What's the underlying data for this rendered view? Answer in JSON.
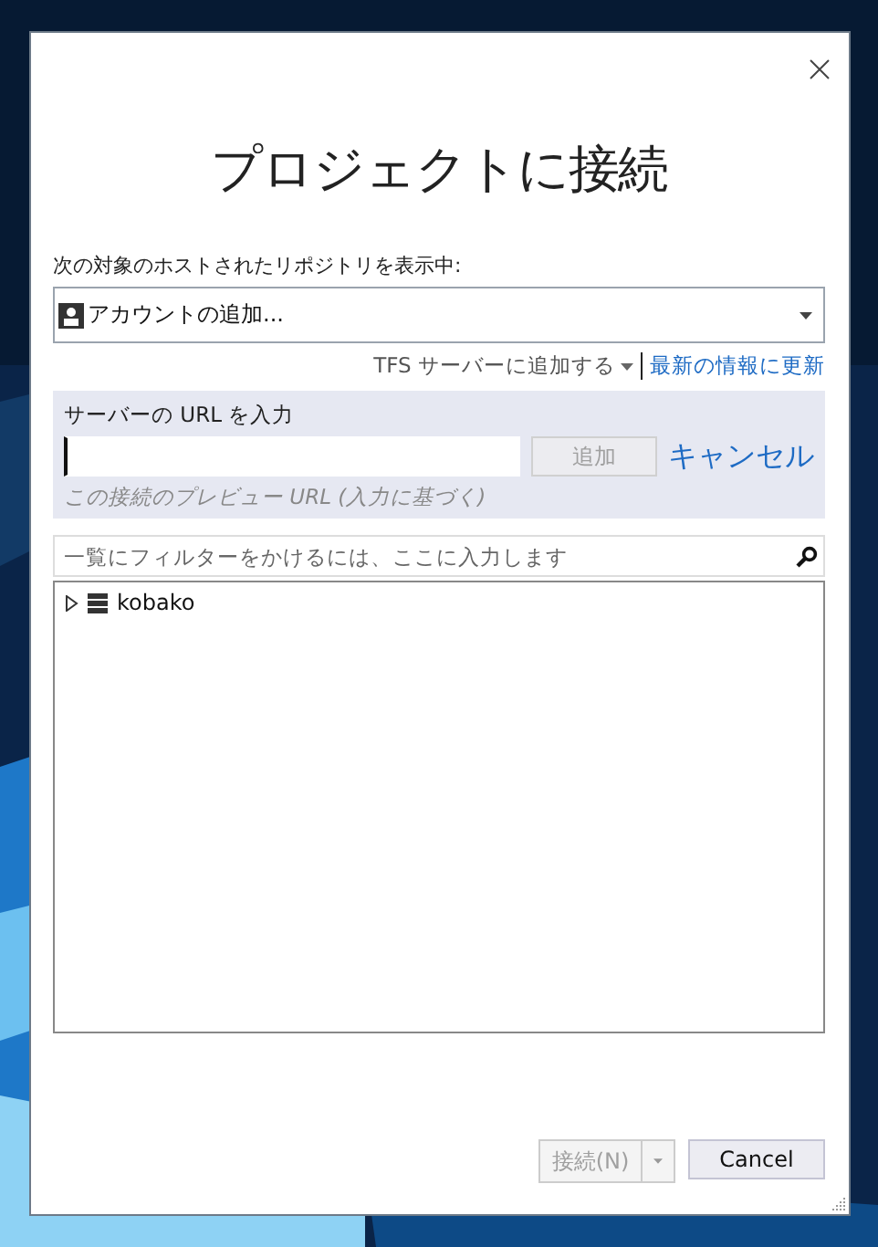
{
  "dialog": {
    "title": "プロジェクトに接続"
  },
  "repository": {
    "label": "次の対象のホストされたリポジトリを表示中:",
    "value": "アカウントの追加..."
  },
  "links": [
    {
      "kind": "menu",
      "label": "TFS サーバーに追加する"
    },
    {
      "kind": "link",
      "label": "最新の情報に更新"
    }
  ],
  "server_panel": {
    "label": "サーバーの URL を入力",
    "add_button": {
      "label": "追加",
      "disabled": true
    },
    "cancel_link": "キャンセル",
    "hint": "この接続のプレビュー URL (入力に基づく)"
  },
  "filter": {
    "placeholder": "一覧にフィルターをかけるには、ここに入力します"
  },
  "tree": [
    {
      "label": "kobako",
      "expanded": false
    }
  ],
  "buttons": [
    {
      "kind": "split",
      "label": "接続(N)",
      "disabled": true
    },
    {
      "kind": "plain",
      "label": "Cancel",
      "disabled": false
    }
  ]
}
